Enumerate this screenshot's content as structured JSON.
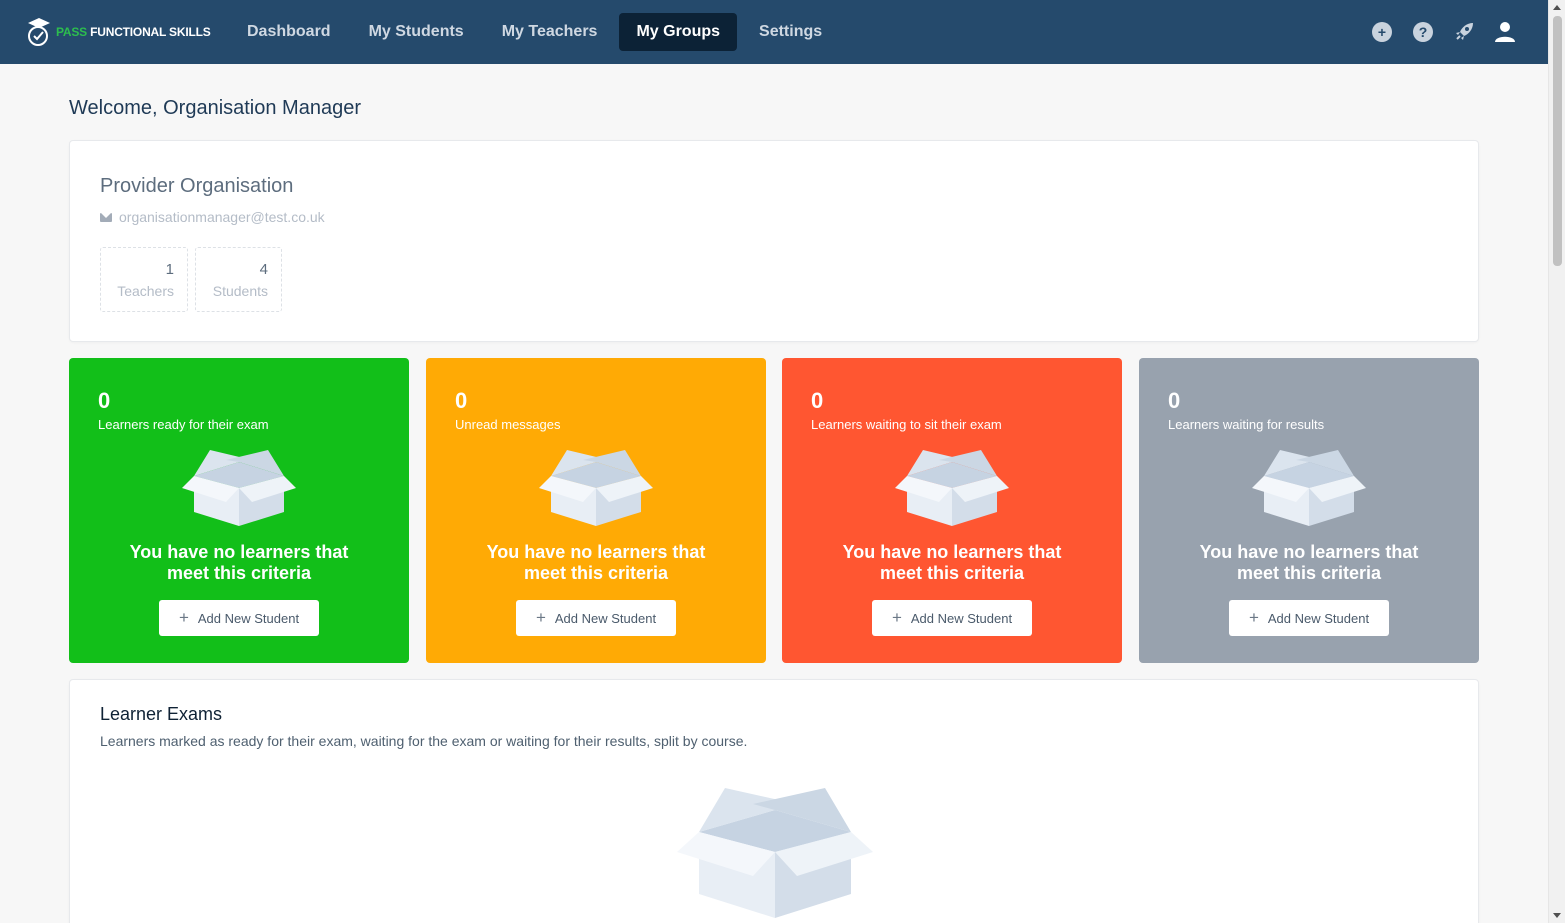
{
  "brand": {
    "pass": "PASS",
    "rest": "FUNCTIONAL SKILLS"
  },
  "nav": {
    "items": [
      {
        "label": "Dashboard"
      },
      {
        "label": "My Students"
      },
      {
        "label": "My Teachers"
      },
      {
        "label": "My Groups"
      },
      {
        "label": "Settings"
      }
    ],
    "active": "My Groups",
    "icons": [
      "add-icon",
      "help-icon",
      "rocket-icon",
      "user-icon"
    ]
  },
  "welcome": "Welcome, Organisation Manager",
  "organisation": {
    "name": "Provider Organisation",
    "email": "organisationmanager@test.co.uk",
    "stats": [
      {
        "count": "1",
        "label": "Teachers"
      },
      {
        "count": "4",
        "label": "Students"
      }
    ]
  },
  "tiles": [
    {
      "count": "0",
      "label": "Learners ready for their exam",
      "message_line1": "You have no learners that",
      "message_line2": "meet this criteria",
      "button": "Add New Student",
      "color": "#12bf19"
    },
    {
      "count": "0",
      "label": "Unread messages",
      "message_line1": "You have no learners that",
      "message_line2": "meet this criteria",
      "button": "Add New Student",
      "color": "#ffaa05"
    },
    {
      "count": "0",
      "label": "Learners waiting to sit their exam",
      "message_line1": "You have no learners that",
      "message_line2": "meet this criteria",
      "button": "Add New Student",
      "color": "#ff5631"
    },
    {
      "count": "0",
      "label": "Learners waiting for results",
      "message_line1": "You have no learners that",
      "message_line2": "meet this criteria",
      "button": "Add New Student",
      "color": "#98a2ae"
    }
  ],
  "exams": {
    "title": "Learner Exams",
    "subtitle": "Learners marked as ready for their exam, waiting for the exam or waiting for their results, split by course."
  },
  "colors": {
    "nav_bg": "#254a6c",
    "nav_active": "#0c2236",
    "brand_green": "#2dbd4e"
  }
}
